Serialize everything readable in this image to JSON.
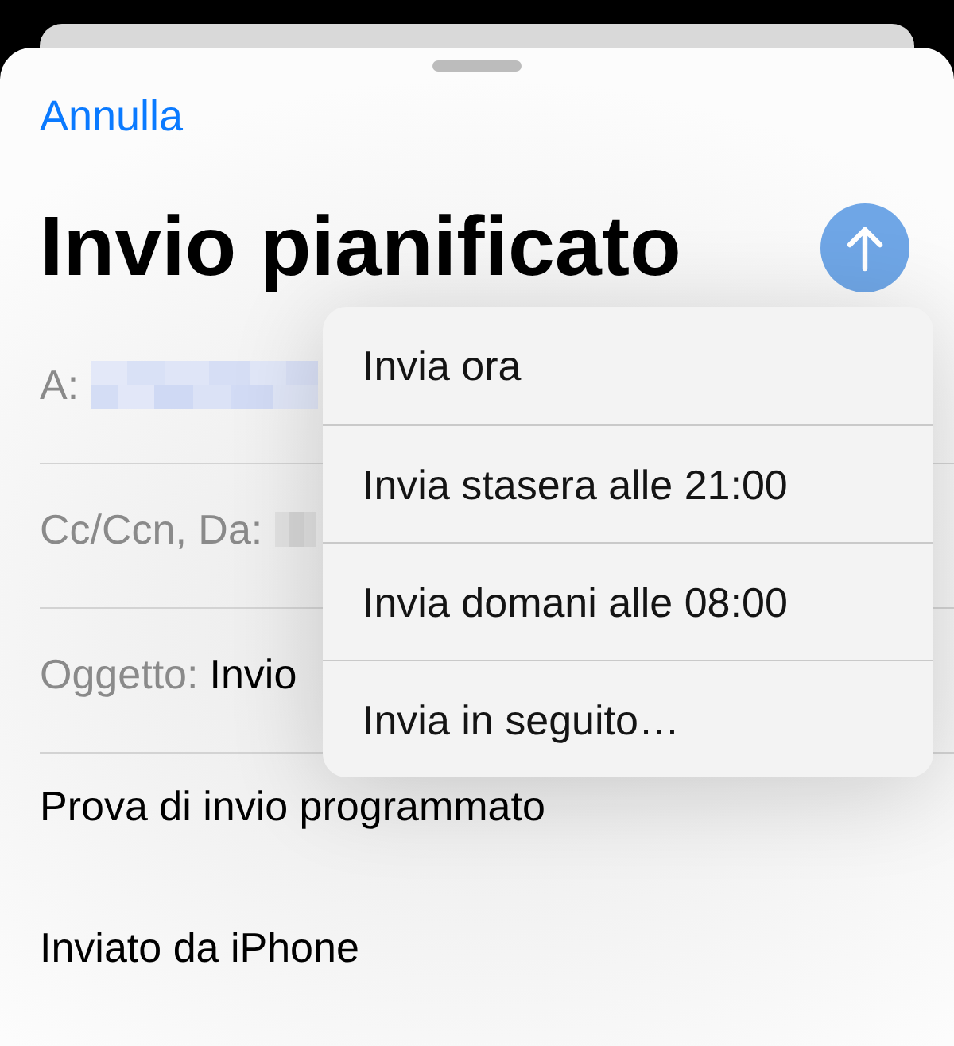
{
  "sheet": {
    "cancel": "Annulla",
    "title": "Invio pianificato"
  },
  "fields": [
    {
      "kind": "recipient",
      "label": "A:"
    },
    {
      "kind": "sender",
      "label": "Cc/Ccn, Da:"
    },
    {
      "kind": "subject",
      "label": "Oggetto:",
      "value": "Invio"
    }
  ],
  "body": [
    "Prova di invio programmato",
    "Inviato da iPhone"
  ],
  "send_menu": {
    "items": [
      "Invia ora",
      "Invia stasera alle 21:00",
      "Invia domani alle 08:00",
      "Invia in seguito…"
    ]
  }
}
